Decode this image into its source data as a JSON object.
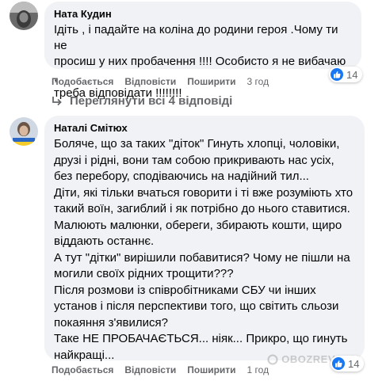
{
  "comment1": {
    "author": "Ната Кудин",
    "lines": [
      "Ідіть , і падайте на коліна до родини героя .Чому ти не",
      "просиш у них пробачення !!!! Особисто я не вибачаю ,",
      "треба відповідати !!!!!!!!"
    ],
    "actions": {
      "like": "Подобається",
      "reply": "Відповісти",
      "share": "Поширити",
      "time": "3 год"
    },
    "reaction_count": "14"
  },
  "view_replies": "Переглянути всі 4 відповіді",
  "comment2": {
    "author": "Наталі Смітюх",
    "lines": [
      "Боляче, що за таких \"діток\" Гинуть хлопці, чоловіки,",
      "друзі і рідні, вони там собою прикривають нас усіх,",
      "без перебору, сподіваючись на надійний тил...",
      "Діти, які тільки вчаться говорити і ті вже розуміють хто",
      "такий воїн, загиблий і як потрібно до нього ставитися.",
      "Малюють малюнки, обереги, збирають кошти, щиро",
      "віддають останнє.",
      "А тут \"дітки\" вирішили побавитися? Чому не пішли на",
      "могили своїх рідних трощити???",
      "Після розмови із співробітниками СБУ чи інших",
      "установ і після перспективи того, що світить сльози",
      "покаяння з'явилися?",
      "Таке НЕ ПРОБАЧАЄТЬСЯ... ніяк... Прикро, що гинуть",
      "найкращі..."
    ],
    "actions": {
      "like": "Подобається",
      "reply": "Відповісти",
      "share": "Поширити",
      "time": "1 год"
    },
    "reaction_count": "14"
  },
  "watermark": "OBOZREVATEL",
  "colors": {
    "bubble": "#f0f2f5",
    "secondary_text": "#65676b",
    "like_blue": "#1877f2"
  }
}
